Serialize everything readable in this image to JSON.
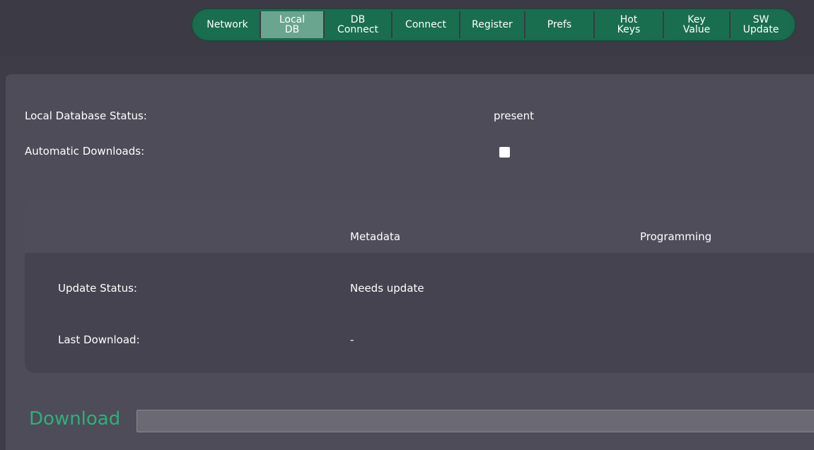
{
  "tabs": [
    {
      "label": "Network"
    },
    {
      "label": "Local\nDB"
    },
    {
      "label": "DB\nConnect"
    },
    {
      "label": "Connect"
    },
    {
      "label": "Register"
    },
    {
      "label": "Prefs"
    },
    {
      "label": "Hot\nKeys"
    },
    {
      "label": "Key\nValue"
    },
    {
      "label": "SW\nUpdate"
    }
  ],
  "active_tab": "Local DB",
  "status": {
    "db_status_label": "Local Database Status:",
    "db_status_value": "present",
    "auto_download_label": "Automatic Downloads:",
    "auto_download_checked": false
  },
  "table": {
    "col_metadata": "Metadata",
    "col_programming": "Programming",
    "row_update_label": "Update Status:",
    "row_update_metadata": "Needs update",
    "row_last_label": "Last Download:",
    "row_last_metadata": "-"
  },
  "download": {
    "label": "Download",
    "progress": 0
  },
  "colors": {
    "accent_green": "#1b6b4e",
    "active_tab": "#6aa590",
    "download_label": "#2db07c"
  }
}
